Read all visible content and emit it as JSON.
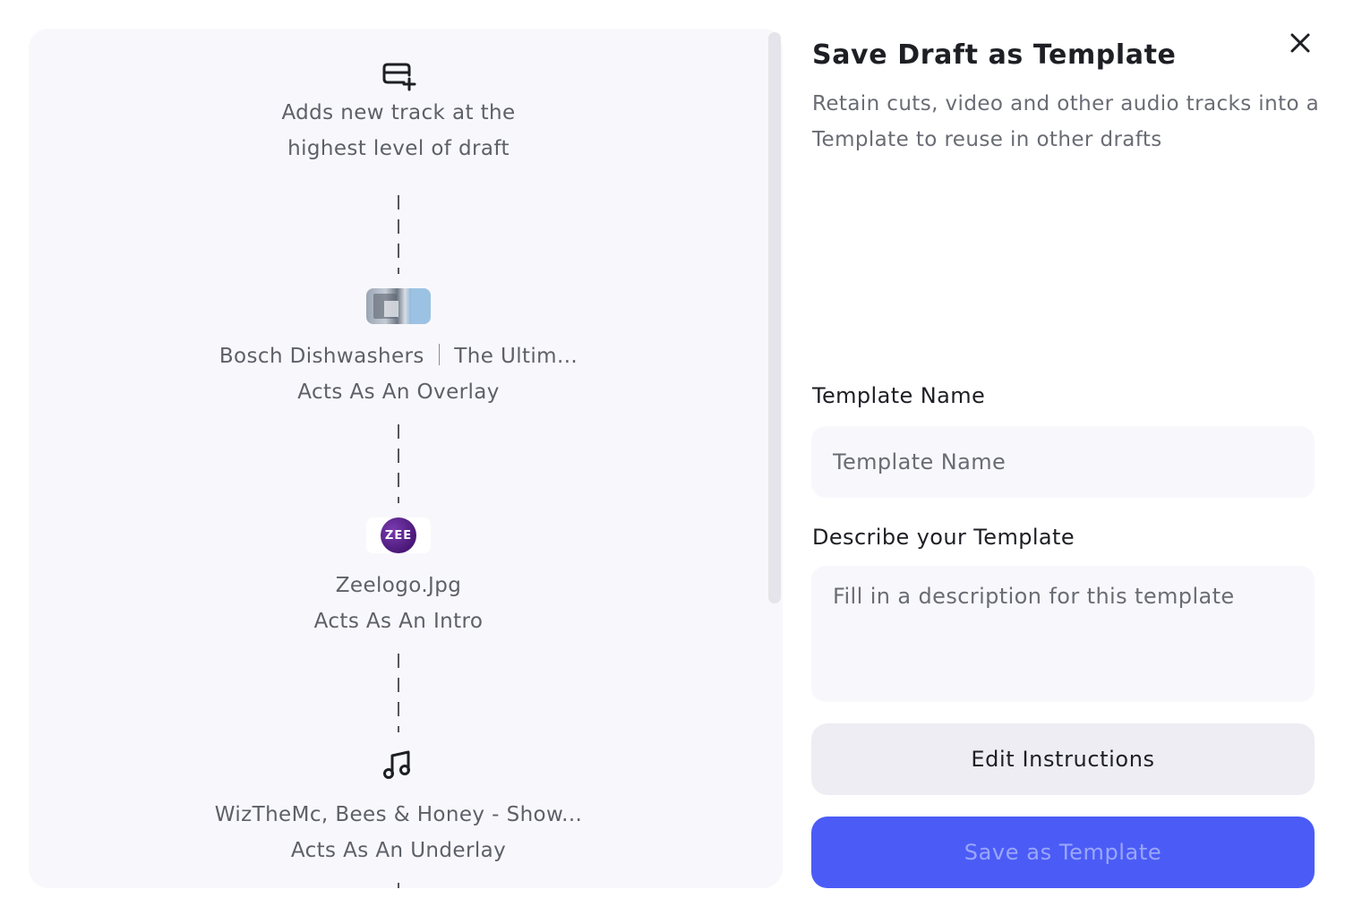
{
  "dialog": {
    "title": "Save Draft as Template",
    "subtitle": "Retain cuts, video and other audio tracks into a Template to reuse in other drafts",
    "close_icon": "close-icon"
  },
  "tracks": [
    {
      "icon": "add-track-icon",
      "line1": "Adds new track at the",
      "line2": "highest level of draft"
    },
    {
      "icon": "video-thumbnail",
      "line1_a": "Bosch Dishwashers",
      "line1_b": "The Ultim...",
      "line2": "Acts As An Overlay"
    },
    {
      "icon": "zee-logo-thumbnail",
      "logo_text": "ZEE",
      "line1": "Zeelogo.Jpg",
      "line2": "Acts As An Intro"
    },
    {
      "icon": "music-note-icon",
      "line1": "WizTheMc, Bees & Honey - Show...",
      "line2": "Acts As An Underlay"
    }
  ],
  "form": {
    "name_label": "Template Name",
    "name_placeholder": "Template Name",
    "name_value": "",
    "description_label": "Describe your Template",
    "description_placeholder": "Fill in a description for this template",
    "description_value": ""
  },
  "buttons": {
    "edit_instructions": "Edit Instructions",
    "save_as_template": "Save as Template"
  },
  "colors": {
    "primary": "#4b5cf6",
    "primary_text_disabled": "#9aa6fb",
    "panel_bg": "#f8f8fc",
    "secondary_btn_bg": "#ededf3"
  }
}
